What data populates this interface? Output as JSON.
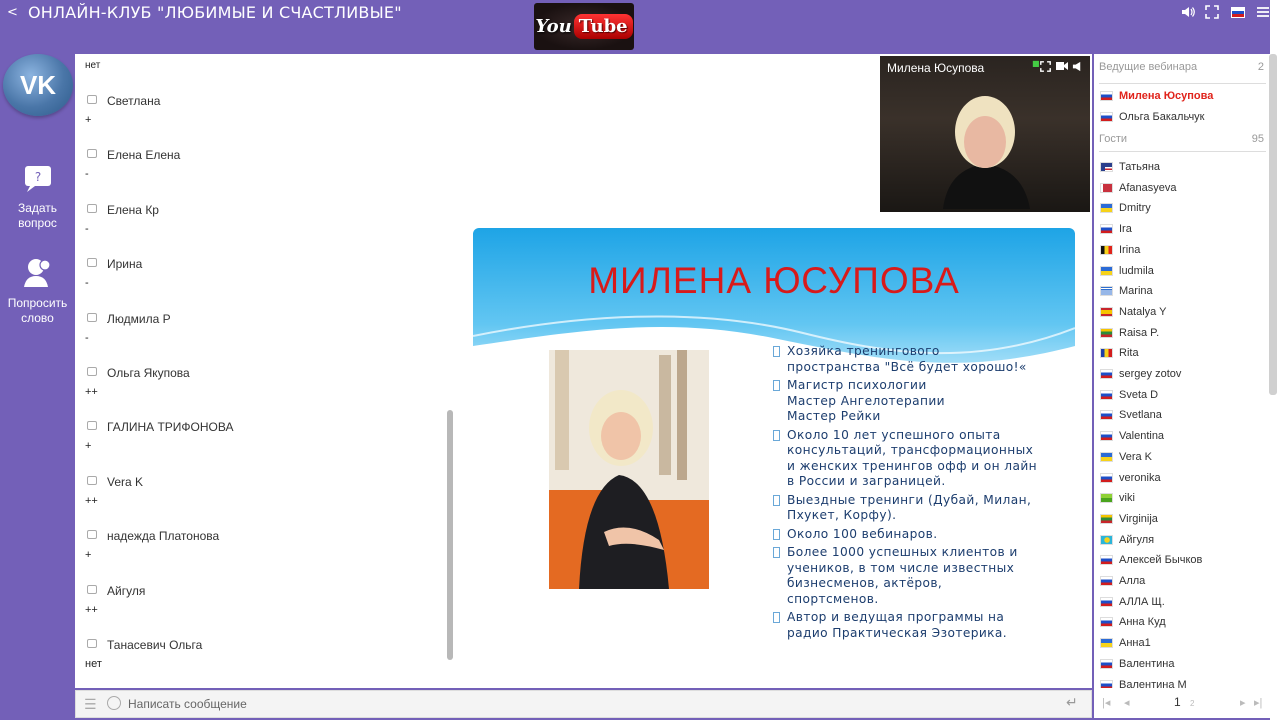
{
  "topbar": {
    "title": "ОНЛАЙН-КЛУБ \"ЛЮБИМЫЕ И СЧАСТЛИВЫЕ\"",
    "youtube_you": "You",
    "youtube_tube": "Tube"
  },
  "rail": {
    "vk_logo": "VK",
    "ask_label_1": "Задать",
    "ask_label_2": "вопрос",
    "speak_label_1": "Попросить",
    "speak_label_2": "слово"
  },
  "chat": {
    "first_text": "нет",
    "messages": [
      {
        "author": "Светлана",
        "text": "+"
      },
      {
        "author": "Елена Елена",
        "text": "-"
      },
      {
        "author": "Елена Кр",
        "text": "-"
      },
      {
        "author": "Ирина",
        "text": "-"
      },
      {
        "author": "Людмила Р",
        "text": "-"
      },
      {
        "author": "Ольга Якупова",
        "text": "++"
      },
      {
        "author": "ГАЛИНА ТРИФОНОВА",
        "text": "+"
      },
      {
        "author": "Vera K",
        "text": "++"
      },
      {
        "author": "надежда Платонова",
        "text": "+"
      },
      {
        "author": "Айгуля",
        "text": "++"
      },
      {
        "author": "Танасевич Ольга",
        "text": "нет"
      }
    ],
    "input_placeholder": "Написать сообщение"
  },
  "video": {
    "presenter_name": "Милена Юсупова"
  },
  "slide": {
    "title": "МИЛЕНА ЮСУПОВА",
    "bullets": [
      "Хозяйка тренингового\nпространства \"Всё будет хорошо!«",
      "Магистр психологии\nМастер Ангелотерапии\nМастер Рейки",
      "Около 10 лет успешного опыта\nконсультаций, трансформационных\nи женских тренингов офф и он лайн\nв России и заграницей.",
      "Выездные тренинги (Дубай, Милан,\nПхукет, Корфу).",
      "Около 100 вебинаров.",
      "Более 1000 успешных клиентов и\nучеников, в том числе известных\nбизнесменов, актёров,\nспортсменов.",
      "Автор и ведущая программы на\nрадио Практическая Эзотерика."
    ]
  },
  "participants": {
    "hosts_label": "Ведущие вебинара",
    "hosts_count": "2",
    "hosts": [
      {
        "name": "Милена Юсупова",
        "flag": "ru",
        "active": true
      },
      {
        "name": "Ольга Бакальчук",
        "flag": "ru",
        "active": false
      }
    ],
    "guests_label": "Гости",
    "guests_count": "95",
    "guests": [
      {
        "name": "Татьяна",
        "flag": "us"
      },
      {
        "name": "Afanasyeva",
        "flag": "by"
      },
      {
        "name": "Dmitry",
        "flag": "ua"
      },
      {
        "name": "Ira",
        "flag": "ru"
      },
      {
        "name": "Irina",
        "flag": "be"
      },
      {
        "name": "ludmila",
        "flag": "ua"
      },
      {
        "name": "Marina",
        "flag": "gr"
      },
      {
        "name": "Natalya Y",
        "flag": "es"
      },
      {
        "name": "Raisa P.",
        "flag": "lt"
      },
      {
        "name": "Rita",
        "flag": "ro"
      },
      {
        "name": "sergey zotov",
        "flag": "ru"
      },
      {
        "name": "Sveta D",
        "flag": "ru"
      },
      {
        "name": "Svetlana",
        "flag": "ru"
      },
      {
        "name": "Valentina",
        "flag": "ru"
      },
      {
        "name": "Vera K",
        "flag": "ua"
      },
      {
        "name": "veronika",
        "flag": "ru"
      },
      {
        "name": "viki",
        "flag": "ng"
      },
      {
        "name": "Virginija",
        "flag": "lt"
      },
      {
        "name": "Айгуля",
        "flag": "kz"
      },
      {
        "name": "Алексей Бычков",
        "flag": "ru"
      },
      {
        "name": "Алла",
        "flag": "ru"
      },
      {
        "name": "АЛЛА Щ.",
        "flag": "ru"
      },
      {
        "name": "Анна Куд",
        "flag": "ru"
      },
      {
        "name": "Анна1",
        "flag": "ua"
      },
      {
        "name": "Валентина",
        "flag": "ru"
      },
      {
        "name": "Валентина М",
        "flag": "ru"
      }
    ],
    "pager_current": "1",
    "pager_next": "2"
  },
  "colors": {
    "background": "#7360b8",
    "host_active": "#e0231b",
    "slide_title": "#d81a1a",
    "bullet_text": "#1c3d6e"
  }
}
